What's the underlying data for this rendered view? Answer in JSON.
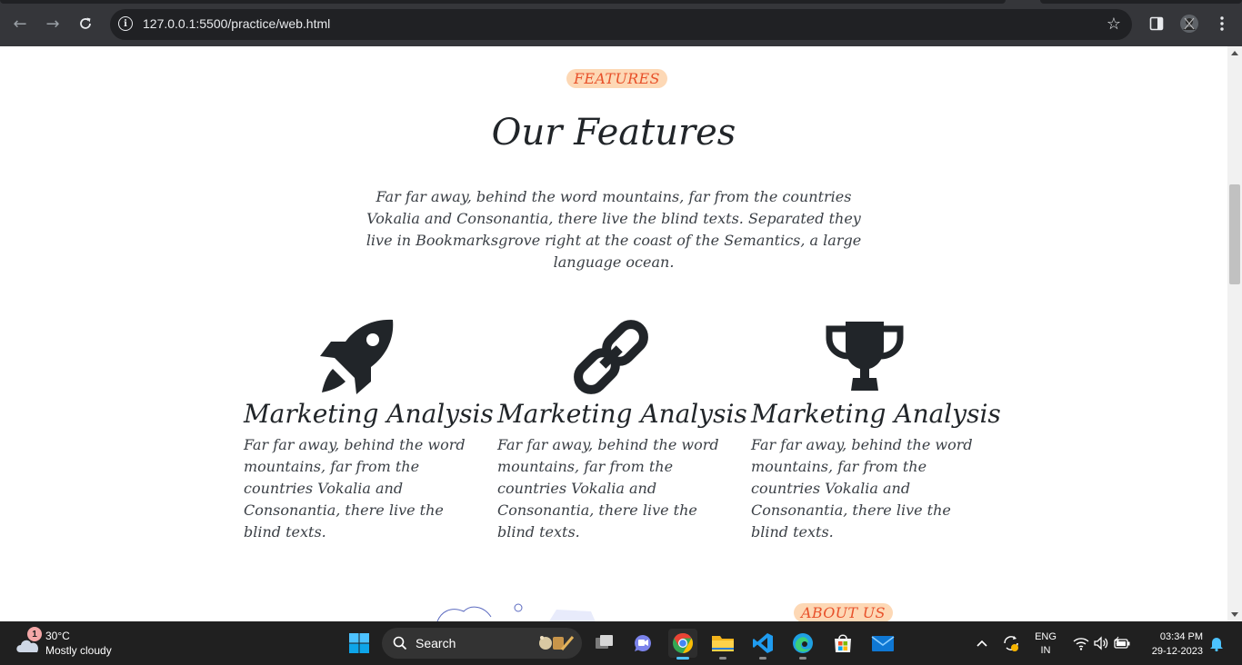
{
  "browser": {
    "url": "127.0.0.1:5500/practice/web.html"
  },
  "features_section": {
    "badge": "FEATURES",
    "title": "Our Features",
    "intro": "Far far away, behind the word mountains, far from the countries Vokalia and Consonantia, there live the blind texts. Separated they live in Bookmarksgrove right at the coast of the Semantics, a large language ocean.",
    "items": [
      {
        "icon": "rocket-icon",
        "title": "Marketing Analysis",
        "text": "Far far away, behind the word mountains, far from the countries Vokalia and Consonantia, there live the blind texts."
      },
      {
        "icon": "link-icon",
        "title": "Marketing Analysis",
        "text": "Far far away, behind the word mountains, far from the countries Vokalia and Consonantia, there live the blind texts."
      },
      {
        "icon": "trophy-icon",
        "title": "Marketing Analysis",
        "text": "Far far away, behind the word mountains, far from the countries Vokalia and Consonantia, there live the blind texts."
      }
    ]
  },
  "about_section": {
    "badge": "ABOUT US"
  },
  "taskbar": {
    "weather_temp": "30°C",
    "weather_condition": "Mostly cloudy",
    "weather_badge": "1",
    "search_label": "Search",
    "language_line1": "ENG",
    "language_line2": "IN",
    "time": "03:34 PM",
    "date": "29-12-2023"
  },
  "colors": {
    "badge_bg": "#fdd8b5",
    "badge_text": "#e8512a",
    "icon_dark": "#212529",
    "chrome_bg": "#35363a",
    "taskbar_bg": "#202020"
  }
}
